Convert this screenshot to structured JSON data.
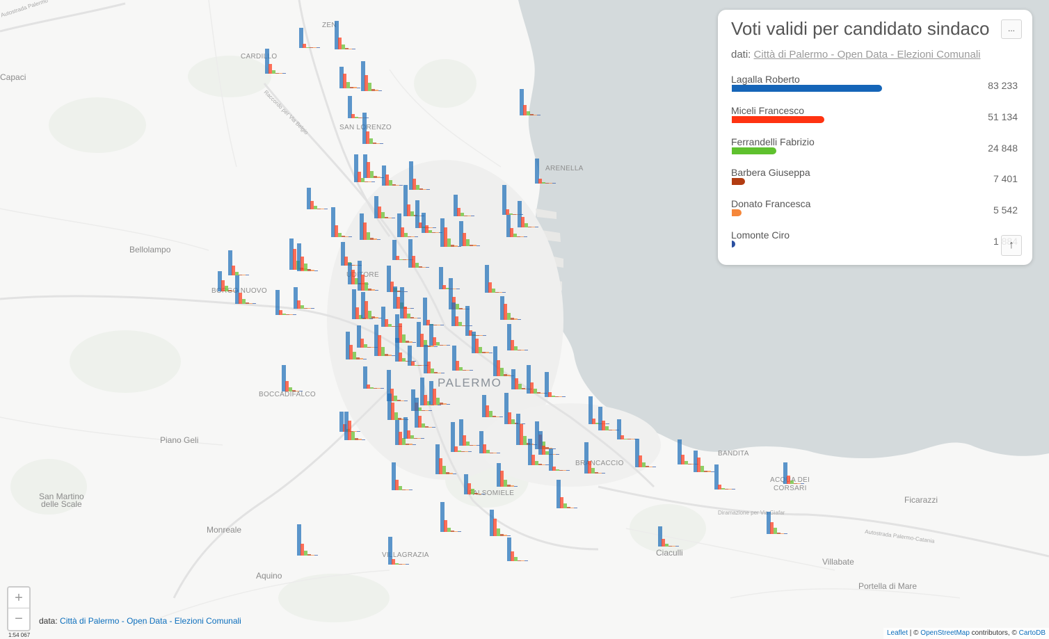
{
  "map": {
    "places": [
      {
        "id": "zen",
        "label": "ZEN",
        "cls": "small"
      },
      {
        "id": "cardillo",
        "label": "CARDILLO",
        "cls": "small"
      },
      {
        "id": "capaci",
        "label": "Capaci",
        "cls": "medium"
      },
      {
        "id": "san-lorenzo",
        "label": "SAN LORENZO",
        "cls": "small"
      },
      {
        "id": "arenella",
        "label": "ARENELLA",
        "cls": "small"
      },
      {
        "id": "bellolampo",
        "label": "Bellolampo",
        "cls": "medium"
      },
      {
        "id": "uditore",
        "label": "UDITORE",
        "cls": "small"
      },
      {
        "id": "borgo-nuovo",
        "label": "BORGO NUOVO",
        "cls": "small"
      },
      {
        "id": "palermo",
        "label": "PALERMO",
        "cls": "city"
      },
      {
        "id": "boccadifalco",
        "label": "BOCCADIFALCO",
        "cls": "small"
      },
      {
        "id": "piano-geli",
        "label": "Piano Geli",
        "cls": "medium"
      },
      {
        "id": "brancaccio",
        "label": "BRANCACCIO",
        "cls": "small"
      },
      {
        "id": "bandita",
        "label": "BANDITA",
        "cls": "small"
      },
      {
        "id": "acqua-dei-corsari-1",
        "label": "ACQUA DEI",
        "cls": "small"
      },
      {
        "id": "acqua-dei-corsari-2",
        "label": "CORSARI",
        "cls": "small"
      },
      {
        "id": "san-martino-1",
        "label": "San Martino",
        "cls": "medium"
      },
      {
        "id": "san-martino-2",
        "label": "delle Scale",
        "cls": "medium"
      },
      {
        "id": "falsomiele",
        "label": "FALSOMIELE",
        "cls": "small"
      },
      {
        "id": "ficarazzi",
        "label": "Ficarazzi",
        "cls": "medium"
      },
      {
        "id": "monreale",
        "label": "Monreale",
        "cls": "medium"
      },
      {
        "id": "villagrazia",
        "label": "VILLAGRAZIA",
        "cls": "small"
      },
      {
        "id": "ciaculli",
        "label": "Ciaculli",
        "cls": "medium"
      },
      {
        "id": "villabate",
        "label": "Villabate",
        "cls": "medium"
      },
      {
        "id": "aquino",
        "label": "Aquino",
        "cls": "medium"
      },
      {
        "id": "portella",
        "label": "Portella di Mare",
        "cls": "medium"
      },
      {
        "id": "road-palermo",
        "label": "Autostrada Palermo",
        "cls": "road"
      },
      {
        "id": "road-belgio",
        "label": "Raccordo per Via Belgio",
        "cls": "road"
      },
      {
        "id": "road-diramazione",
        "label": "Diramazione per Via Giafar",
        "cls": "road"
      },
      {
        "id": "road-catania",
        "label": "Autostrada Palermo-Catania",
        "cls": "road"
      }
    ],
    "district_votes": [
      [
        14000,
        2700,
        700,
        450,
        300,
        100
      ],
      [
        9000,
        3600,
        1500,
        350,
        260,
        80
      ],
      [
        16000,
        6200,
        2400,
        600,
        420,
        140
      ],
      [
        11000,
        7400,
        3100,
        850,
        600,
        190
      ],
      [
        6500,
        3500,
        1800,
        420,
        300,
        90
      ],
      [
        12500,
        4800,
        2000,
        520,
        400,
        120
      ]
    ],
    "colors": [
      "#1e6fb9",
      "#ff3a1a",
      "#65bf2e",
      "#b83c14",
      "#f6893a",
      "#2d56a6"
    ],
    "sea_color": "#d4dadc",
    "land_color": "#f7f7f6"
  },
  "panel": {
    "title": "Voti validi per candidato sindaco",
    "menu_label": "...",
    "source_prefix": "dati:",
    "source_link": "Città di Palermo - Open Data - Elezioni Comunali",
    "candidates": [
      {
        "name": "Lagalla Roberto",
        "votes": 83233,
        "votes_label": "83 233",
        "color": "#1565b8"
      },
      {
        "name": "Miceli Francesco",
        "votes": 51134,
        "votes_label": "51 134",
        "color": "#ff3311"
      },
      {
        "name": "Ferrandelli Fabrizio",
        "votes": 24848,
        "votes_label": "24 848",
        "color": "#5fc12e"
      },
      {
        "name": "Barbera Giuseppa",
        "votes": 7401,
        "votes_label": "7 401",
        "color": "#b23c12"
      },
      {
        "name": "Donato Francesca",
        "votes": 5542,
        "votes_label": "5 542",
        "color": "#f5873a"
      },
      {
        "name": "Lomonte Ciro",
        "votes": 1884,
        "votes_label": "1 884",
        "color": "#2a4fa0"
      }
    ],
    "up_label": "↑"
  },
  "controls": {
    "zoom_in": "+",
    "zoom_out": "−",
    "scale": "1:54 067"
  },
  "credit": {
    "prefix": "data:",
    "link": "Città di Palermo - Open Data - Elezioni Comunali"
  },
  "attribution": {
    "leaflet": "Leaflet",
    "sep": " | © ",
    "osm": "OpenStreetMap",
    "contrib": " contributors, © ",
    "carto": "CartoDB"
  }
}
